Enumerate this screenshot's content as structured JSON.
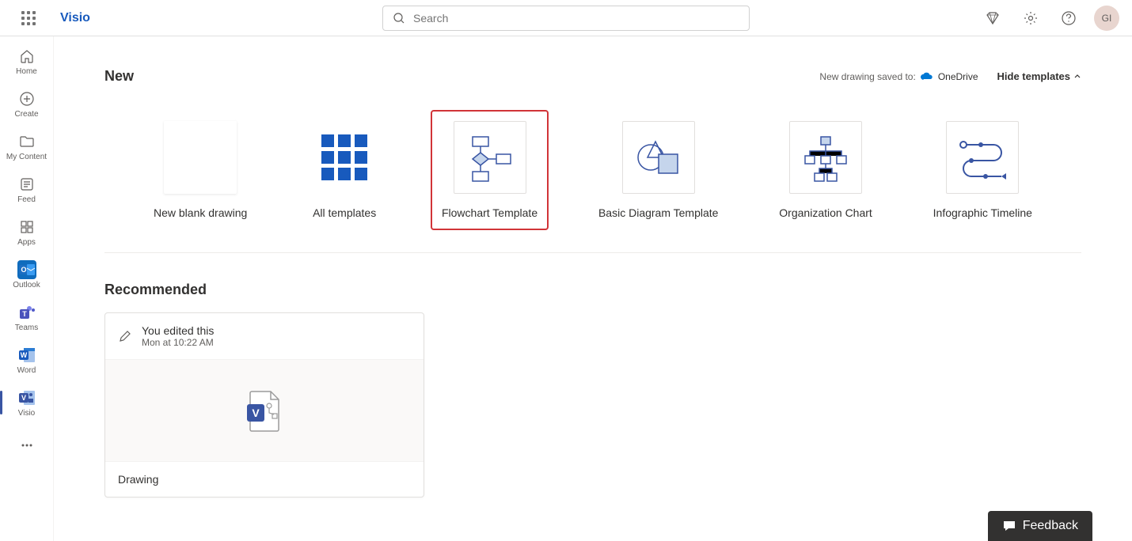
{
  "header": {
    "app_name": "Visio",
    "search_placeholder": "Search",
    "avatar_initials": "GI"
  },
  "rail": {
    "items": [
      {
        "label": "Home"
      },
      {
        "label": "Create"
      },
      {
        "label": "My Content"
      },
      {
        "label": "Feed"
      },
      {
        "label": "Apps"
      },
      {
        "label": "Outlook"
      },
      {
        "label": "Teams"
      },
      {
        "label": "Word"
      },
      {
        "label": "Visio"
      }
    ]
  },
  "new_section": {
    "title": "New",
    "save_label": "New drawing saved to:",
    "save_location": "OneDrive",
    "hide_label": "Hide templates",
    "templates": [
      {
        "label": "New blank drawing"
      },
      {
        "label": "All templates"
      },
      {
        "label": "Flowchart Template"
      },
      {
        "label": "Basic Diagram Template"
      },
      {
        "label": "Organization Chart"
      },
      {
        "label": "Infographic Timeline"
      }
    ]
  },
  "recommended": {
    "title": "Recommended",
    "card": {
      "action": "You edited this",
      "time": "Mon at 10:22 AM",
      "name": "Drawing"
    }
  },
  "feedback": {
    "label": "Feedback"
  }
}
